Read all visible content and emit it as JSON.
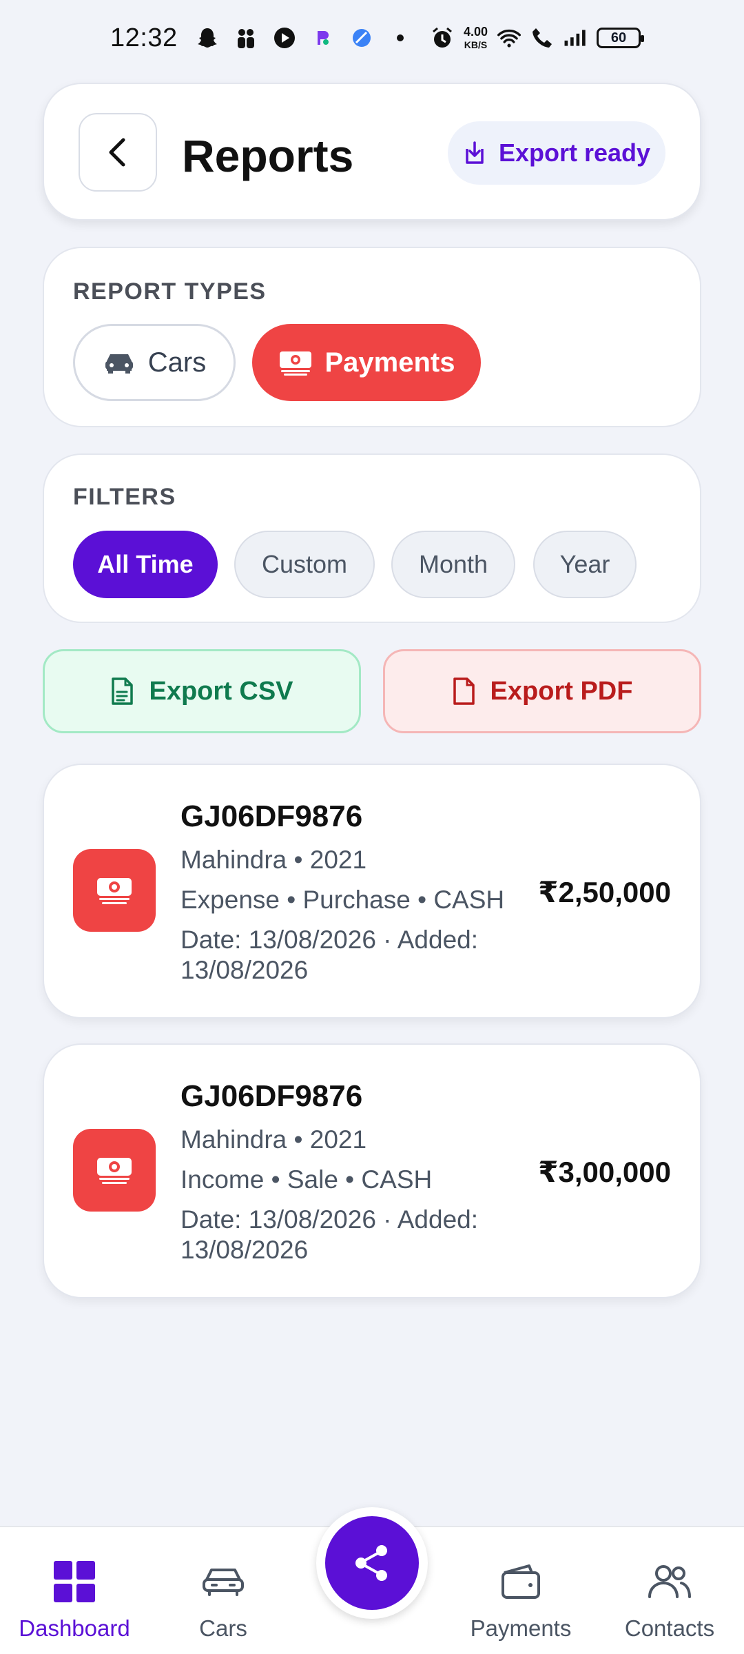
{
  "status_bar": {
    "time": "12:32",
    "speed_value": "4.00",
    "speed_unit": "KB/S",
    "battery": "60"
  },
  "header": {
    "title": "Reports",
    "export_ready_label": "Export ready"
  },
  "report_types": {
    "label": "REPORT TYPES",
    "items": [
      {
        "label": "Cars",
        "selected": false
      },
      {
        "label": "Payments",
        "selected": true
      }
    ]
  },
  "filters": {
    "label": "FILTERS",
    "items": [
      {
        "label": "All Time",
        "selected": true
      },
      {
        "label": "Custom",
        "selected": false
      },
      {
        "label": "Month",
        "selected": false
      },
      {
        "label": "Year",
        "selected": false
      }
    ]
  },
  "export": {
    "csv_label": "Export CSV",
    "pdf_label": "Export PDF"
  },
  "transactions": [
    {
      "plate": "GJ06DF9876",
      "vehicle": "Mahindra • 2021",
      "details": "Expense • Purchase • CASH",
      "dates": "Date: 13/08/2026 · Added: 13/08/2026",
      "amount": "₹2,50,000"
    },
    {
      "plate": "GJ06DF9876",
      "vehicle": "Mahindra • 2021",
      "details": "Income • Sale • CASH",
      "dates": "Date: 13/08/2026 · Added: 13/08/2026",
      "amount": "₹3,00,000"
    }
  ],
  "bottom_nav": {
    "items": [
      {
        "label": "Dashboard",
        "active": true,
        "icon": "grid-icon"
      },
      {
        "label": "Cars",
        "active": false,
        "icon": "car-icon"
      },
      {
        "label": "Payments",
        "active": false,
        "icon": "wallet-icon"
      },
      {
        "label": "Contacts",
        "active": false,
        "icon": "contacts-icon"
      }
    ],
    "fab_icon": "share-icon"
  },
  "colors": {
    "primary": "#5b10d6",
    "danger": "#ef4444",
    "success": "#0f7a4e",
    "background": "#f1f3f9"
  }
}
